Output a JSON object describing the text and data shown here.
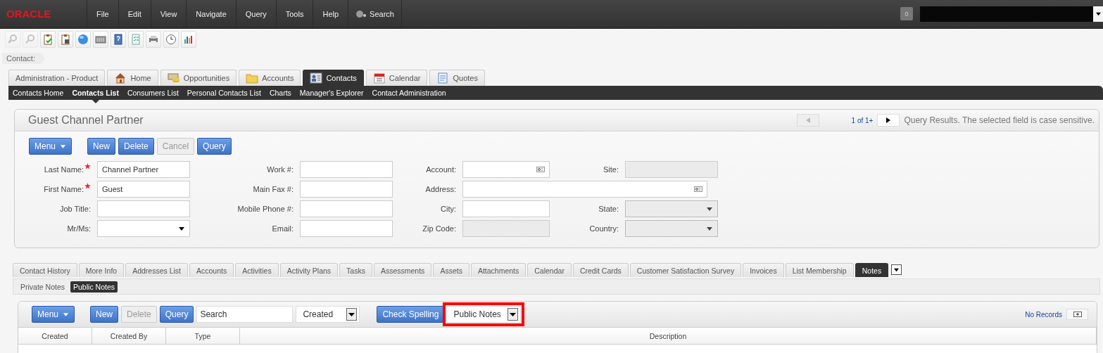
{
  "top_bar": {
    "logo": "ORACLE",
    "menu": [
      "File",
      "Edit",
      "View",
      "Navigate",
      "Query",
      "Tools",
      "Help"
    ],
    "search": "Search",
    "badge": "0"
  },
  "toolbar": [
    {
      "kind": "find-add",
      "disabled": true
    },
    {
      "kind": "find",
      "disabled": true
    },
    {
      "kind": "clipboard-check",
      "disabled": false
    },
    {
      "kind": "clipboard-save",
      "disabled": false
    },
    {
      "kind": "globe",
      "disabled": false
    },
    {
      "kind": "keypad",
      "disabled": false
    },
    {
      "kind": "help-book",
      "disabled": false
    },
    {
      "kind": "checklist",
      "disabled": false
    },
    {
      "kind": "printer",
      "disabled": false
    },
    {
      "kind": "clock",
      "disabled": false
    },
    {
      "kind": "bar-chart",
      "disabled": false
    }
  ],
  "breadcrumb": "Contact:",
  "screen_tabs": [
    {
      "label": "Administration - Product",
      "kind": "plain",
      "selected": false
    },
    {
      "label": "Home",
      "kind": "home",
      "selected": false
    },
    {
      "label": "Opportunities",
      "kind": "money",
      "selected": false
    },
    {
      "label": "Accounts",
      "kind": "folder",
      "selected": false
    },
    {
      "label": "Contacts",
      "kind": "card",
      "selected": true
    },
    {
      "label": "Calendar",
      "kind": "calendar",
      "selected": false
    },
    {
      "label": "Quotes",
      "kind": "document",
      "selected": false
    }
  ],
  "subnav": [
    {
      "label": "Contacts Home",
      "selected": false
    },
    {
      "label": "Contacts List",
      "selected": true
    },
    {
      "label": "Consumers List",
      "selected": false
    },
    {
      "label": "Personal Contacts List",
      "selected": false
    },
    {
      "label": "Charts",
      "selected": false
    },
    {
      "label": "Manager's Explorer",
      "selected": false
    },
    {
      "label": "Contact Administration",
      "selected": false
    }
  ],
  "form_applet": {
    "title": "Guest Channel Partner",
    "pager": {
      "prev_disabled": true,
      "count": "1 of 1+"
    },
    "status": "Query Results.  The selected field is case sensitive.",
    "buttons": [
      {
        "label": "Menu",
        "kind": "menu",
        "disabled": false
      },
      {
        "label": "New",
        "kind": "button",
        "disabled": false
      },
      {
        "label": "Delete",
        "kind": "button",
        "disabled": false
      },
      {
        "label": "Cancel",
        "kind": "button",
        "disabled": true
      },
      {
        "label": "Query",
        "kind": "button",
        "disabled": false
      }
    ],
    "fields": [
      {
        "label": "Last Name:",
        "kind": "text",
        "required": true,
        "value": "Channel Partner"
      },
      {
        "label": "Work #:",
        "kind": "text",
        "required": false
      },
      {
        "label": "Account:",
        "kind": "lookup",
        "required": false
      },
      {
        "label": "Site:",
        "kind": "readonly",
        "required": false
      },
      {
        "label": "First Name:",
        "kind": "text",
        "required": true,
        "value": "Guest"
      },
      {
        "label": "Main Fax #:",
        "kind": "text",
        "required": false
      },
      {
        "label": "Address:",
        "kind": "wide_lookup",
        "required": false
      },
      {
        "label": "Job Title:",
        "kind": "text",
        "required": false
      },
      {
        "label": "Mobile Phone #:",
        "kind": "text",
        "required": false
      },
      {
        "label": "City:",
        "kind": "text",
        "required": false
      },
      {
        "label": "State:",
        "kind": "select",
        "required": false,
        "disabled": true
      },
      {
        "label": "Mr/Ms:",
        "kind": "select",
        "required": false,
        "disabled": false
      },
      {
        "label": "Email:",
        "kind": "text",
        "required": false
      },
      {
        "label": "Zip Code:",
        "kind": "readonly",
        "required": false
      },
      {
        "label": "Country:",
        "kind": "select",
        "required": false,
        "disabled": true
      }
    ]
  },
  "view_tabs": [
    {
      "label": "Contact History",
      "selected": false
    },
    {
      "label": "More Info",
      "selected": false
    },
    {
      "label": "Addresses List",
      "selected": false
    },
    {
      "label": "Accounts",
      "selected": false
    },
    {
      "label": "Activities",
      "selected": false
    },
    {
      "label": "Activity Plans",
      "selected": false
    },
    {
      "label": "Tasks",
      "selected": false
    },
    {
      "label": "Assessments",
      "selected": false
    },
    {
      "label": "Assets",
      "selected": false
    },
    {
      "label": "Attachments",
      "selected": false
    },
    {
      "label": "Calendar",
      "selected": false
    },
    {
      "label": "Credit Cards",
      "selected": false
    },
    {
      "label": "Customer Satisfaction Survey",
      "selected": false
    },
    {
      "label": "Invoices",
      "selected": false
    },
    {
      "label": "List Membership",
      "selected": false
    },
    {
      "label": "Notes",
      "selected": true
    }
  ],
  "note_tabs": [
    {
      "label": "Private Notes",
      "selected": false
    },
    {
      "label": "Public Notes",
      "selected": true
    }
  ],
  "list_applet": {
    "buttons": [
      {
        "label": "Menu",
        "kind": "menu",
        "disabled": false
      },
      {
        "label": "New",
        "kind": "button",
        "disabled": false
      },
      {
        "label": "Delete",
        "kind": "button",
        "disabled": true
      },
      {
        "label": "Query",
        "kind": "button",
        "disabled": false
      }
    ],
    "search": {
      "placeholder": "Search"
    },
    "sort_select": "Created",
    "check_spelling": "Check Spelling",
    "notes_select": {
      "value": "Public Notes",
      "highlighted": true
    },
    "records": "No Records",
    "columns": [
      "Created",
      "Created By",
      "Type",
      "Description"
    ]
  }
}
